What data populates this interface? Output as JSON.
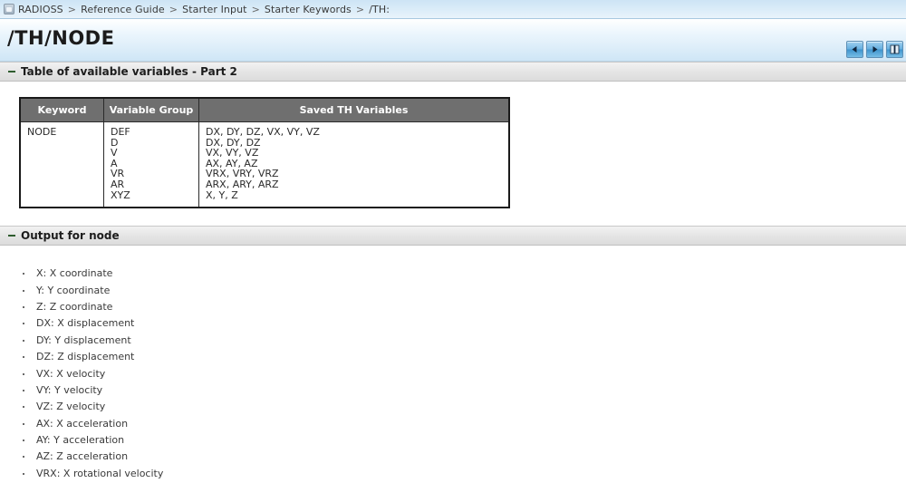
{
  "breadcrumb": {
    "home_icon": "home-icon",
    "items": [
      "RADIOSS",
      "Reference Guide",
      "Starter Input",
      "Starter Keywords",
      "/TH:"
    ],
    "separator": ">"
  },
  "header": {
    "title": "/TH/NODE",
    "nav": {
      "previous": {
        "icon": "left-arrow-icon",
        "label": "Previous"
      },
      "next": {
        "icon": "right-arrow-icon",
        "label": "Next"
      },
      "book": {
        "icon": "book-icon",
        "label": "Show in Contents"
      }
    }
  },
  "sections": [
    {
      "toggle_icon": "minus-icon",
      "title": "Table of available variables - Part 2"
    },
    {
      "toggle_icon": "minus-icon",
      "title": "Output for node"
    }
  ],
  "table": {
    "headers": [
      "Keyword",
      "Variable Group",
      "Saved TH Variables"
    ],
    "rows": [
      {
        "keyword": "NODE",
        "groups": [
          "DEF",
          "D",
          "V",
          "A",
          "VR",
          "AR",
          "XYZ"
        ],
        "saved": [
          "DX, DY, DZ, VX, VY, VZ",
          "DX, DY, DZ",
          "VX, VY, VZ",
          "AX, AY, AZ",
          "VRX, VRY, VRZ",
          "ARX, ARY, ARZ",
          "X, Y, Z"
        ]
      }
    ]
  },
  "output_list": [
    "X: X coordinate",
    "Y: Y coordinate",
    "Z: Z coordinate",
    "DX: X displacement",
    "DY: Y displacement",
    "DZ: Z displacement",
    "VX: X velocity",
    "VY: Y velocity",
    "VZ: Z velocity",
    "AX: X acceleration",
    "AY: Y acceleration",
    "AZ: Z acceleration",
    "VRX: X rotational velocity"
  ],
  "colors": {
    "breadcrumb_bg": "#d9ebf8",
    "title_gradient_end": "#cfe6f6",
    "section_bar": "#e4e4e4",
    "table_header_bg": "#6f6f6f",
    "nav_button_blue": "#3f93cd",
    "toggle_green": "#2e5c2e"
  }
}
